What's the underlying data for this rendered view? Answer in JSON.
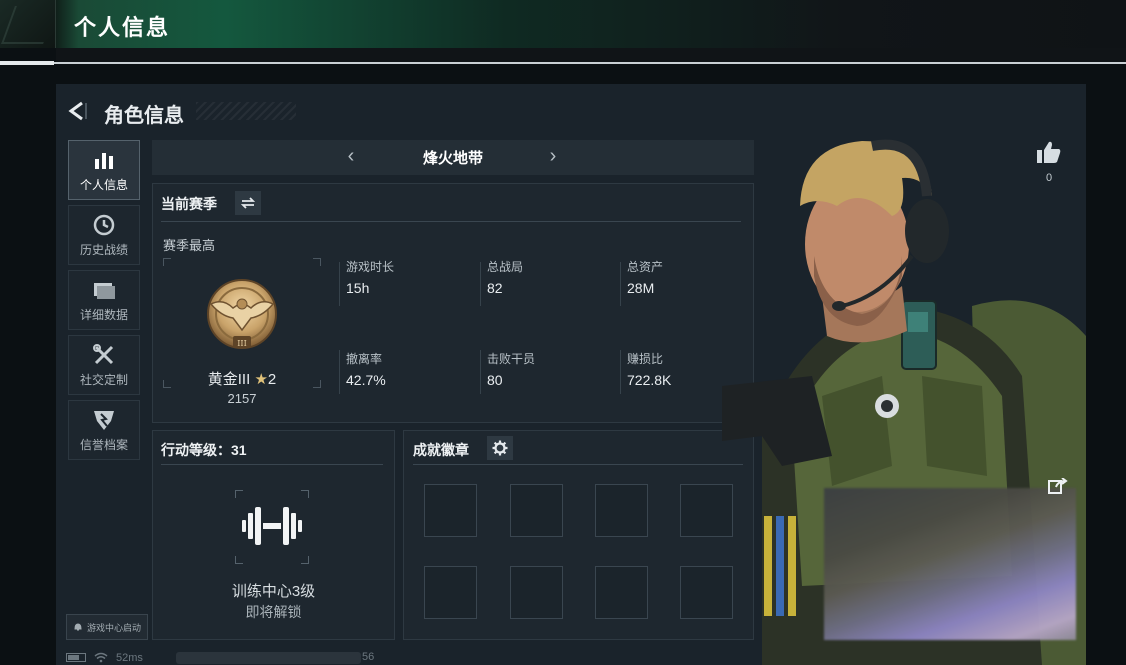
{
  "header": {
    "title": "个人信息"
  },
  "page": {
    "title": "角色信息"
  },
  "sidebar": {
    "items": [
      {
        "label": "个人信息",
        "icon": "bar-chart-icon",
        "active": true
      },
      {
        "label": "历史战绩",
        "icon": "history-clock-icon",
        "active": false
      },
      {
        "label": "详细数据",
        "icon": "folder-icon",
        "active": false
      },
      {
        "label": "社交定制",
        "icon": "tools-icon",
        "active": false
      },
      {
        "label": "信誉档案",
        "icon": "reputation-badge-icon",
        "active": false
      }
    ],
    "launch_label": "游戏中心启动"
  },
  "status_bar": {
    "ping": "52ms",
    "trailing": "56"
  },
  "map_selector": {
    "current": "烽火地带",
    "prev_symbol": "‹",
    "next_symbol": "›"
  },
  "season": {
    "title": "当前赛季",
    "subtitle": "赛季最高",
    "rank_name": "黄金III",
    "rank_star_symbol": "★",
    "rank_stars": "2",
    "rank_badge_numeral": "III",
    "rank_score": "2157",
    "stats": [
      {
        "label": "游戏时长",
        "value": "15h"
      },
      {
        "label": "总战局",
        "value": "82"
      },
      {
        "label": "总资产",
        "value": "28M"
      },
      {
        "label": "撤离率",
        "value": "42.7%"
      },
      {
        "label": "击败干员",
        "value": "80"
      },
      {
        "label": "赚损比",
        "value": "722.8K"
      }
    ]
  },
  "action_level": {
    "title": "行动等级：31",
    "training_name": "训练中心3级",
    "training_status": "即将解锁"
  },
  "achievements": {
    "title": "成就徽章",
    "slot_count": 8
  },
  "social": {
    "like_count": "0"
  },
  "colors": {
    "panel_bg": "#1e272f",
    "main_bg": "#1a232b",
    "header_green": "#14583e",
    "gold": "#c9a36a"
  }
}
